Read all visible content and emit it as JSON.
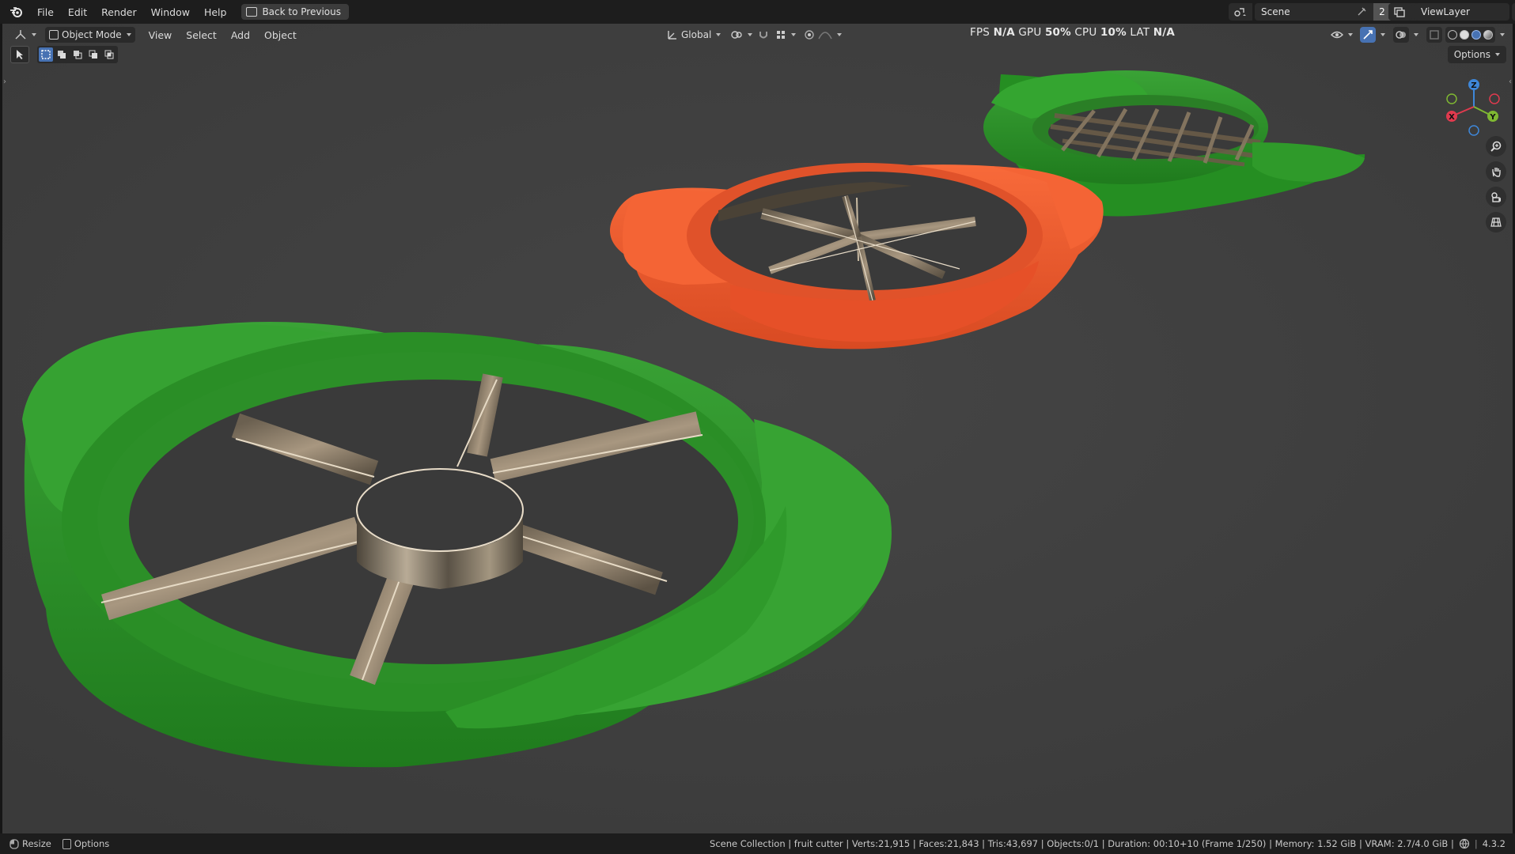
{
  "topbar": {
    "menus": [
      "File",
      "Edit",
      "Render",
      "Window",
      "Help"
    ],
    "back_button": "Back to Previous",
    "scene_name": "Scene",
    "scene_users": "2",
    "view_layer": "ViewLayer"
  },
  "viewport": {
    "mode": "Object Mode",
    "menus": [
      "View",
      "Select",
      "Add",
      "Object"
    ],
    "transform_orientation": "Global",
    "options_label": "Options",
    "hud": {
      "fps_label": "FPS",
      "fps_value": "N/A",
      "gpu_label": "GPU",
      "gpu_value": "50%",
      "cpu_label": "CPU",
      "cpu_value": "10%",
      "lat_label": "LAT",
      "lat_value": "N/A"
    },
    "gizmo_axes": {
      "x": "X",
      "y": "Y",
      "z": "Z"
    }
  },
  "statusbar": {
    "left": [
      "Resize",
      "Options"
    ],
    "stats": "Scene Collection | fruit cutter | Verts:21,915 | Faces:21,843 | Tris:43,697 | Objects:0/1 | Duration: 00:10+10 (Frame 1/250) | Memory: 1.52 GiB | VRAM: 2.7/4.0 GiB |",
    "version": "4.3.2"
  },
  "colors": {
    "green_cutter": "#2f9a2a",
    "orange_cutter": "#f05a2c",
    "blade": "#8a7a62",
    "viewport_bg": "#3f3f3f",
    "accent_blue": "#4772b3"
  }
}
